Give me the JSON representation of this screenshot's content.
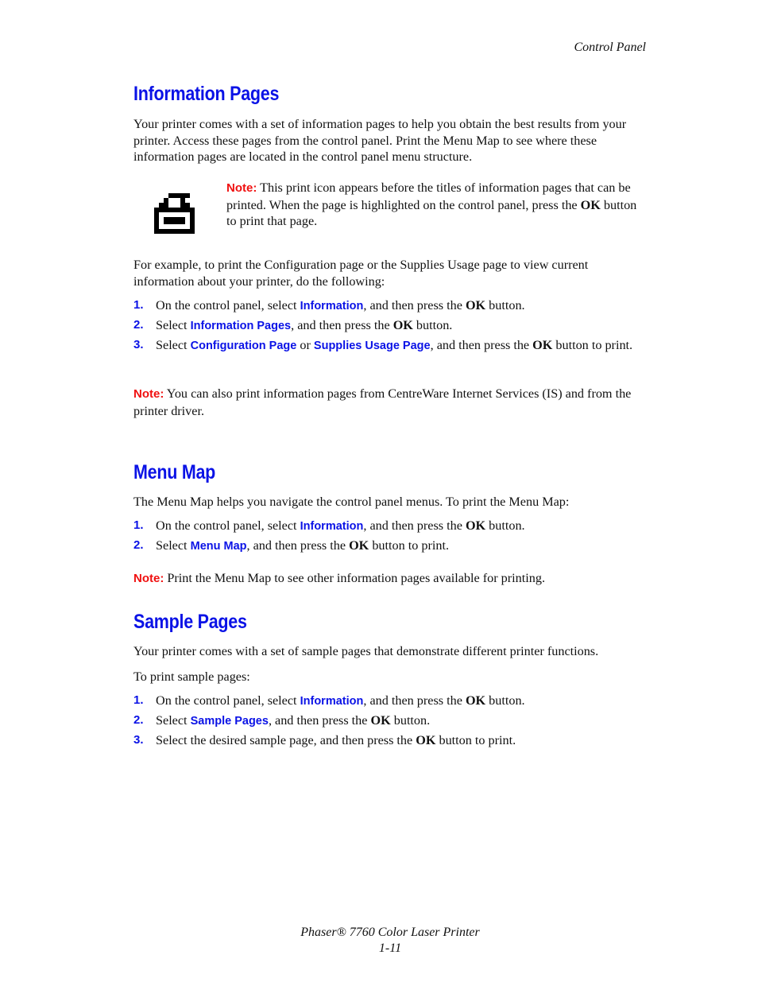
{
  "header": {
    "running_title": "Control Panel"
  },
  "sections": {
    "info": {
      "title": "Information Pages",
      "intro": "Your printer comes with a set of information pages to help you obtain the best results from your printer. Access these pages from the control panel. Print the Menu Map to see where these information pages are located in the control panel menu structure.",
      "icon": "print-icon",
      "icon_note": {
        "label": "Note:",
        "text_before": " This print icon appears before the titles of information pages that can be printed. When the page is highlighted on the control panel, press the ",
        "ok": "OK",
        "text_after": " button to print that page."
      },
      "example": "For example, to print the Configuration page or the Supplies Usage page to view current information about your printer, do the following:",
      "steps": [
        {
          "num": "1.",
          "a": "On the control panel, select ",
          "ui": "Information",
          "b": ", and then press the ",
          "ok": "OK",
          "c": " button."
        },
        {
          "num": "2.",
          "a": "Select ",
          "ui": "Information Pages",
          "b": ", and then press the ",
          "ok": "OK",
          "c": " button."
        },
        {
          "num": "3.",
          "a": "Select ",
          "ui": "Configuration Page",
          "or": " or ",
          "ui2": "Supplies Usage Page",
          "b": ", and then press the ",
          "ok": "OK",
          "c": " button to print."
        }
      ],
      "note": {
        "label": "Note:",
        "text": " You can also print information pages from CentreWare Internet Services (IS) and from the printer driver."
      }
    },
    "menu_map": {
      "title": "Menu Map",
      "intro": "The Menu Map helps you navigate the control panel menus. To print the Menu Map:",
      "steps": [
        {
          "num": "1.",
          "a": "On the control panel, select ",
          "ui": "Information",
          "b": ", and then press the ",
          "ok": "OK",
          "c": " button."
        },
        {
          "num": "2.",
          "a": "Select ",
          "ui": "Menu Map",
          "b": ", and then press the ",
          "ok": "OK",
          "c": " button to print."
        }
      ],
      "note": {
        "label": "Note:",
        "text": " Print the Menu Map to see other information pages available for printing."
      }
    },
    "sample": {
      "title": "Sample Pages",
      "intro": "Your printer comes with a set of sample pages that demonstrate different printer functions.",
      "lead": "To print sample pages:",
      "steps": [
        {
          "num": "1.",
          "a": "On the control panel, select ",
          "ui": "Information",
          "b": ", and then press the ",
          "ok": "OK",
          "c": " button."
        },
        {
          "num": "2.",
          "a": "Select ",
          "ui": "Sample Pages",
          "b": ", and then press the ",
          "ok": "OK",
          "c": " button."
        },
        {
          "num": "3.",
          "a": "Select the desired sample page, and then press the ",
          "ok": "OK",
          "c": " button to print."
        }
      ]
    }
  },
  "footer": {
    "product": "Phaser® 7760 Color Laser Printer",
    "page_number": "1-11"
  },
  "colors": {
    "heading_blue": "#0a12e6",
    "note_red": "#f01010",
    "text": "#111111"
  }
}
